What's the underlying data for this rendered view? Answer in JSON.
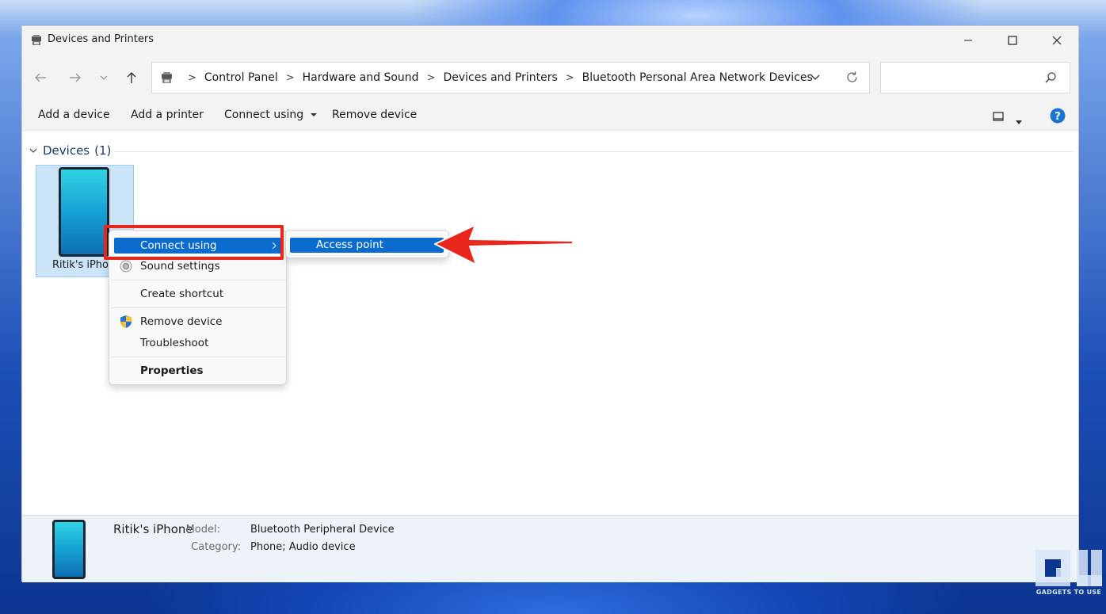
{
  "window": {
    "title": "Devices and Printers",
    "icons": {
      "app": "devices-printers-icon",
      "minimize": "minimize-icon",
      "maximize": "maximize-icon",
      "close": "close-icon"
    }
  },
  "address_bar": {
    "breadcrumbs": [
      "Control Panel",
      "Hardware and Sound",
      "Devices and Printers",
      "Bluetooth Personal Area Network Devices"
    ],
    "search_placeholder": ""
  },
  "toolbar": {
    "add_device": "Add a device",
    "add_printer": "Add a printer",
    "connect_using": "Connect using",
    "remove_device": "Remove device"
  },
  "devices_group": {
    "label": "Devices",
    "count": "(1)",
    "items": [
      {
        "name": "Ritik's iPhon",
        "icon": "phone-icon"
      }
    ]
  },
  "context_menu": {
    "items": [
      {
        "label": "Connect using",
        "highlighted": true,
        "has_submenu": true
      },
      {
        "label": "Sound settings",
        "icon": "speaker-icon"
      },
      {
        "label": "Create shortcut"
      },
      {
        "label": "Remove device",
        "icon": "uac-shield-icon"
      },
      {
        "label": "Troubleshoot"
      },
      {
        "label": "Properties",
        "bold": true
      }
    ],
    "submenu": [
      {
        "label": "Access point",
        "highlighted": true
      }
    ]
  },
  "details_pane": {
    "name": "Ritik's iPhone",
    "model_label": "Model:",
    "model_value": "Bluetooth Peripheral Device",
    "category_label": "Category:",
    "category_value": "Phone; Audio device"
  },
  "watermark": {
    "text": "GADGETS TO USE"
  },
  "colors": {
    "accent": "#0b6ccf",
    "annotation_red": "#e8261c",
    "selection": "#cce4f7"
  }
}
